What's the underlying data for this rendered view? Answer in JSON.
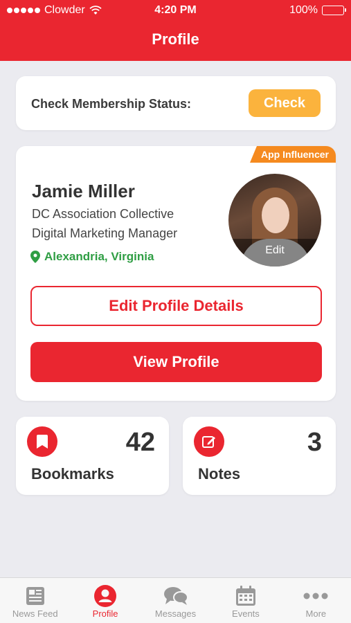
{
  "status_bar": {
    "carrier": "Clowder",
    "time": "4:20 PM",
    "battery": "100%"
  },
  "header": {
    "title": "Profile"
  },
  "membership": {
    "label": "Check Membership Status:",
    "button": "Check"
  },
  "profile": {
    "badge": "App Influencer",
    "name": "Jamie Miller",
    "organization": "DC Association Collective",
    "job_title": "Digital Marketing Manager",
    "location": "Alexandria, Virginia",
    "avatar_edit": "Edit",
    "edit_button": "Edit Profile Details",
    "view_button": "View Profile"
  },
  "stats": {
    "bookmarks": {
      "icon": "bookmark-icon",
      "count": "42",
      "label": "Bookmarks"
    },
    "notes": {
      "icon": "edit-note-icon",
      "count": "3",
      "label": "Notes"
    }
  },
  "tabbar": {
    "items": [
      {
        "label": "News Feed",
        "icon": "newspaper-icon"
      },
      {
        "label": "Profile",
        "icon": "user-icon",
        "active": true
      },
      {
        "label": "Messages",
        "icon": "chat-bubbles-icon"
      },
      {
        "label": "Events",
        "icon": "calendar-icon"
      },
      {
        "label": "More",
        "icon": "more-dots-icon"
      }
    ]
  },
  "colors": {
    "brand_red": "#ea2630",
    "check_orange": "#fbb33d",
    "badge_orange": "#f58a1f",
    "location_green": "#2f9e44",
    "background": "#ebebf0"
  }
}
